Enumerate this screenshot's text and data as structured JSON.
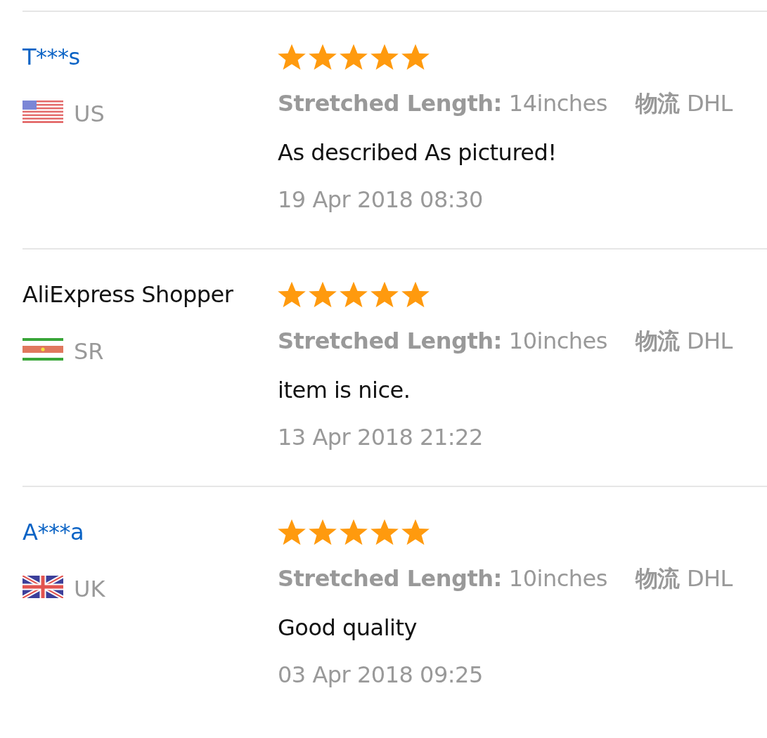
{
  "reviews": [
    {
      "name": "T***s",
      "link": true,
      "country": {
        "kind": "us",
        "code": "US"
      },
      "stars": 5,
      "attributes": [
        {
          "label": "Stretched Length:",
          "value": "14inches"
        },
        {
          "label": "物流",
          "value": "DHL"
        }
      ],
      "comment": "As described As pictured!",
      "date": "19 Apr 2018 08:30"
    },
    {
      "name": "AliExpress Shopper",
      "link": false,
      "country": {
        "kind": "sr",
        "code": "SR"
      },
      "stars": 5,
      "attributes": [
        {
          "label": "Stretched Length:",
          "value": "10inches"
        },
        {
          "label": "物流",
          "value": "DHL"
        }
      ],
      "comment": "item is nice.",
      "date": "13 Apr 2018 21:22"
    },
    {
      "name": "A***a",
      "link": true,
      "country": {
        "kind": "uk",
        "code": "UK"
      },
      "stars": 5,
      "attributes": [
        {
          "label": "Stretched Length:",
          "value": "10inches"
        },
        {
          "label": "物流",
          "value": "DHL"
        }
      ],
      "comment": "Good quality",
      "date": "03 Apr 2018 09:25"
    }
  ]
}
